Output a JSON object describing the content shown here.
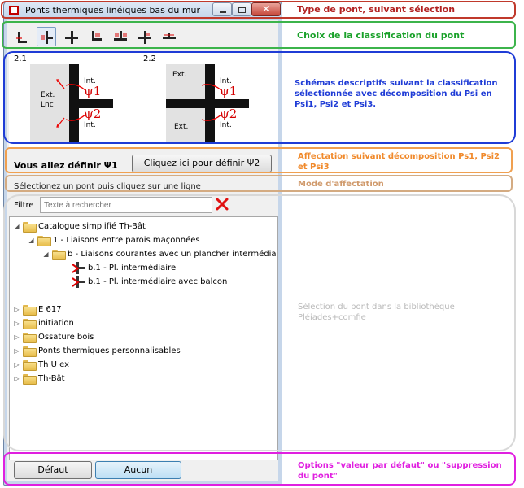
{
  "window": {
    "title": "Ponts thermiques linéiques bas du mur",
    "close_glyph": "✕"
  },
  "toolbar": {
    "buttons": [
      {
        "icon": "junction-L-icon"
      },
      {
        "icon": "junction-T-left-icon",
        "selected": true
      },
      {
        "icon": "junction-cross-icon"
      },
      {
        "icon": "junction-L-red-icon"
      },
      {
        "icon": "junction-T-red-icon"
      },
      {
        "icon": "junction-cross-red-icon"
      },
      {
        "icon": "junction-T-down-icon"
      }
    ]
  },
  "schemas": [
    {
      "id": "2.1",
      "ext": "Ext.",
      "lnc": "Lnc",
      "int_top": "Int.",
      "int_bottom": "Int.",
      "psi1": "ψ1",
      "psi2": "ψ2"
    },
    {
      "id": "2.2",
      "ext_top": "Ext.",
      "ext_bottom": "Ext.",
      "int_top": "Int.",
      "int_bottom": "Int.",
      "psi1": "ψ1",
      "psi2": "ψ2"
    }
  ],
  "define": {
    "label": "Vous allez définir Ψ1",
    "button": "Cliquez ici pour définir Ψ2"
  },
  "hint": "Sélectionez un pont puis cliquez sur une ligne",
  "filter": {
    "label": "Filtre",
    "placeholder": "Texte à rechercher",
    "clear_glyph": "✖"
  },
  "tree": {
    "nodes": [
      {
        "label": "Catalogue simplifié Th-Bât",
        "expanded": true,
        "type": "folder"
      },
      {
        "label": "1 - Liaisons entre parois maçonnées",
        "expanded": true,
        "type": "folder"
      },
      {
        "label": "b - Liaisons courantes avec un plancher intermédia",
        "expanded": true,
        "type": "folder"
      },
      {
        "label": "b.1 - Pl. intermédiaire",
        "type": "leaf"
      },
      {
        "label": "b.1 - Pl. intermédiaire avec balcon",
        "type": "leaf"
      },
      {
        "label": "E 617",
        "expanded": false,
        "type": "folder"
      },
      {
        "label": "initiation",
        "expanded": false,
        "type": "folder"
      },
      {
        "label": "Ossature bois",
        "expanded": false,
        "type": "folder"
      },
      {
        "label": "Ponts thermiques personnalisables",
        "expanded": false,
        "type": "folder"
      },
      {
        "label": "Th U ex",
        "expanded": false,
        "type": "folder"
      },
      {
        "label": "Th-Bât",
        "expanded": false,
        "type": "folder"
      }
    ]
  },
  "buttons": {
    "default": "Défaut",
    "none": "Aucun"
  },
  "annotations": {
    "type": "Type de pont, suivant sélection",
    "classification": "Choix de la classification du pont",
    "schemas": "Schémas descriptifs suivant la classification sélectionnée avec décomposition du Psi en Psi1, Psi2 et Psi3.",
    "affectation": "Affectation suivant décomposition Ps1, Psi2 et Psi3",
    "mode": "Mode d'affectation",
    "selection": "Sélection du pont dans la bibliothèque Pléiades+comfie",
    "options": "Options \"valeur par défaut\" ou \"suppression du pont\""
  },
  "colors": {
    "annotation_red": "#c0392b",
    "annotation_green": "#3cb44b",
    "annotation_blue": "#1f3cd6",
    "annotation_orange": "#f0a050",
    "annotation_tan": "#d4ab82",
    "annotation_gray": "#d8d8d8",
    "annotation_magenta": "#e020e0",
    "psi_red": "#d40000"
  }
}
